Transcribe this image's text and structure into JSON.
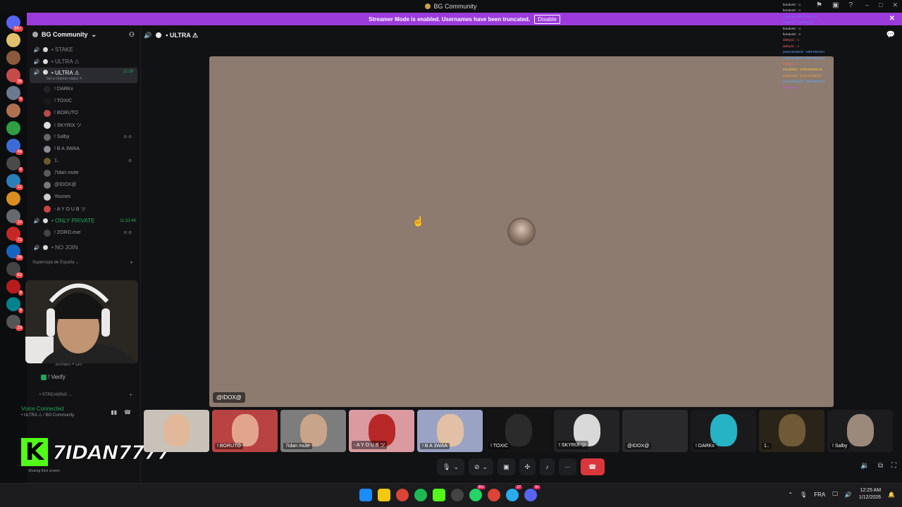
{
  "window": {
    "title": "BG Community"
  },
  "banner": {
    "text": "Streamer Mode is enabled. Usernames have been truncated.",
    "button": "Disable"
  },
  "rail": {
    "servers": [
      {
        "color": "#5865f2",
        "badge": "9K+"
      },
      {
        "color": "#e1c16e",
        "badge": ""
      },
      {
        "color": "#8b5a3c",
        "badge": ""
      },
      {
        "color": "#c74a4a",
        "badge": "36"
      },
      {
        "color": "#6b7a8f",
        "badge": "4"
      },
      {
        "color": "#b07050",
        "badge": ""
      },
      {
        "color": "#2f9e44",
        "badge": ""
      },
      {
        "color": "#3d6bd6",
        "badge": "46"
      },
      {
        "color": "#4a4a4a",
        "badge": "4"
      },
      {
        "color": "#2b7fb8",
        "badge": "12"
      },
      {
        "color": "#d98e1f",
        "badge": ""
      },
      {
        "color": "#666a70",
        "badge": "10"
      },
      {
        "color": "#c62828",
        "badge": "72"
      },
      {
        "color": "#1565c0",
        "badge": "38"
      },
      {
        "color": "#444",
        "badge": "62"
      },
      {
        "color": "#b71c1c",
        "badge": "8"
      },
      {
        "color": "#00838f",
        "badge": "9"
      },
      {
        "color": "#555",
        "badge": "29"
      }
    ]
  },
  "sidebar": {
    "server_name": "BG Community",
    "channels_top": [
      {
        "name": "• STAKE"
      },
      {
        "name": "• ULTRA ⚠"
      }
    ],
    "active_channel": {
      "name": "• ULTRA ⚠",
      "status": "Set a channel status ✎",
      "timer": "11:19"
    },
    "members": [
      {
        "name": "! DARKx",
        "color": "#222",
        "tail": ""
      },
      {
        "name": "! TOXIC",
        "color": "#1a1a1a",
        "tail": ""
      },
      {
        "name": "! BORUTO",
        "color": "#b94a4a",
        "tail": ""
      },
      {
        "name": "! SKYRIX ツ",
        "color": "#ddd",
        "tail": ""
      },
      {
        "name": "! Salby",
        "color": "#666",
        "tail": "⊘ ⊘"
      },
      {
        "name": "! B A 3WAA",
        "color": "#8a8a95",
        "tail": ""
      },
      {
        "name": "1..",
        "color": "#6b5a2e",
        "tail": "⊘"
      },
      {
        "name": "7idan mute",
        "color": "#5a5a5a",
        "tail": ""
      },
      {
        "name": "@IDOX@",
        "color": "#777",
        "tail": ""
      },
      {
        "name": "Younes",
        "color": "#ccc",
        "tail": ""
      },
      {
        "name": "- A Y O U B ツ",
        "color": "#c44",
        "tail": ""
      }
    ],
    "private_channel": {
      "name": "• ONLY PRIVATE",
      "timer": "11:53:46"
    },
    "private_member": {
      "name": "! ZORO.exe",
      "tail": "⊘ ⊘"
    },
    "nojoin": {
      "name": "• NO JOIN"
    },
    "category": {
      "name": "Supercopa de España ⌄"
    },
    "stream_on": "Stream • On",
    "verify": "! Verify",
    "streaming_cat": "• STREAMING ⌄"
  },
  "voice": {
    "status": "Voice Connected",
    "location": "• ULTRA ⚠ / BG Community",
    "sharing": "Sharing their screen"
  },
  "overlay": {
    "k": "K",
    "name": "7IDAN7777"
  },
  "stage": {
    "channel": "• ULTRA ⚠",
    "focused_label": "@IDOX@"
  },
  "chat": [
    {
      "text": "boruto44 : ☺",
      "color": "#ddd"
    },
    {
      "text": "boruto44 : ☺",
      "color": "#ddd"
    },
    {
      "text": "yassinexl : MEKHNOKH",
      "color": "#7a6cff"
    },
    {
      "text": "yassinexl : mekhnokh",
      "color": "#7a6cff"
    },
    {
      "text": "boruto44 : ☺",
      "color": "#ddd"
    },
    {
      "text": "boruto44 : ☺",
      "color": "#ddd"
    },
    {
      "text": "darky11 : ☺",
      "color": "#ff6b6b"
    },
    {
      "text": "darky11 : ☺",
      "color": "#ff6b6b"
    },
    {
      "text": "yassinesalachi : MEKHNOKH",
      "color": "#5aa9ff"
    },
    {
      "text": "yassinesalachi : MEKHNOKH",
      "color": "#5aa9ff"
    },
    {
      "text": "darky11 : ☺",
      "color": "#ff6b6b"
    },
    {
      "text": "KOUBIDE : TARHONHOUS",
      "color": "#ffcc33"
    },
    {
      "text": "sakhiou07 : DAD LKABUTA",
      "color": "#ff9a3d"
    },
    {
      "text": "yassinesalachi : MEKHNOKH",
      "color": "#5aa9ff"
    },
    {
      "text": "ZLATAN : ☺",
      "color": "#d84dff"
    }
  ],
  "tiles": [
    {
      "name": "",
      "bg": "#c9c2b8",
      "face": "#e2b89a"
    },
    {
      "name": "! BORUTO",
      "bg": "#b94242",
      "face": "#e3a48d"
    },
    {
      "name": "7idan mute",
      "bg": "#7d7d7d",
      "face": "#c8a58a"
    },
    {
      "name": "- A Y O U B ツ",
      "bg": "#d99aa0",
      "face": "#b82828"
    },
    {
      "name": "! B A 3WAA",
      "bg": "#9aa3c4",
      "face": "#e1c0a5"
    },
    {
      "name": "! TOXIC",
      "bg": "#141414",
      "face": "#2b2b2b"
    },
    {
      "name": "! SKYRIX ツ",
      "bg": "#232325",
      "face": "#d9d9d9"
    },
    {
      "name": "@IDOX@",
      "bg": "#2a2a2d",
      "face": "#2a2a2d"
    },
    {
      "name": "! DARKx",
      "bg": "#1a1a1c",
      "face": "#26b3c5"
    },
    {
      "name": "1..",
      "bg": "#2a2418",
      "face": "#6e5a36"
    },
    {
      "name": "! Salby",
      "bg": "#1c1c1e",
      "face": "#9b8a7c"
    }
  ],
  "taskbar": {
    "lang": "FRA",
    "time": "12:25 AM",
    "date": "1/12/2026",
    "badges": [
      "99+",
      "27",
      "9+"
    ]
  }
}
